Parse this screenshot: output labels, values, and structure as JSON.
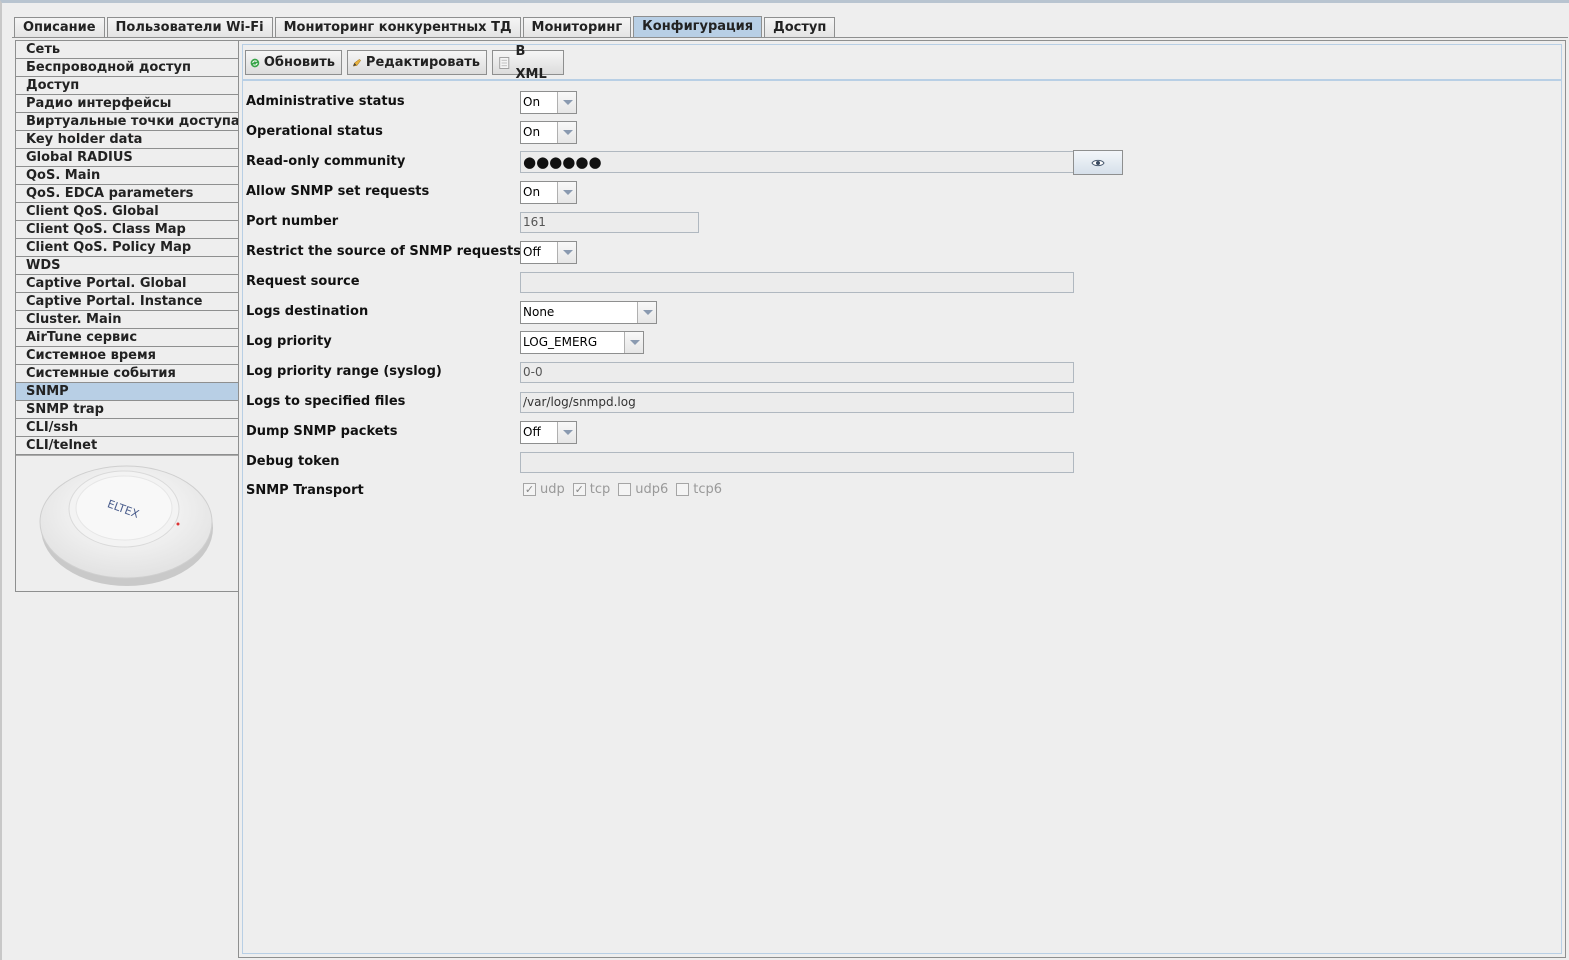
{
  "tabs": [
    {
      "label": "Описание",
      "active": false
    },
    {
      "label": "Пользователи Wi-Fi",
      "active": false
    },
    {
      "label": "Мониторинг конкурентных ТД",
      "active": false
    },
    {
      "label": "Мониторинг",
      "active": false
    },
    {
      "label": "Конфигурация",
      "active": true
    },
    {
      "label": "Доступ",
      "active": false
    }
  ],
  "sidebar": {
    "items": [
      {
        "label": "Сеть"
      },
      {
        "label": "Беспроводной доступ"
      },
      {
        "label": "Доступ"
      },
      {
        "label": "Радио интерфейсы"
      },
      {
        "label": "Виртуальные точки доступа"
      },
      {
        "label": "Key holder data"
      },
      {
        "label": "Global RADIUS"
      },
      {
        "label": "QoS. Main"
      },
      {
        "label": "QoS. EDCA parameters"
      },
      {
        "label": "Client QoS. Global"
      },
      {
        "label": "Client QoS. Class Map"
      },
      {
        "label": "Client QoS. Policy Map"
      },
      {
        "label": "WDS"
      },
      {
        "label": "Captive Portal. Global"
      },
      {
        "label": "Captive Portal. Instance"
      },
      {
        "label": "Cluster. Main"
      },
      {
        "label": "AirTune сервис"
      },
      {
        "label": "Системное время"
      },
      {
        "label": "Системные события"
      },
      {
        "label": "SNMP",
        "selected": true
      },
      {
        "label": "SNMP trap"
      },
      {
        "label": "CLI/ssh"
      },
      {
        "label": "CLI/telnet"
      }
    ],
    "device_logo_text": "ELTEX"
  },
  "toolbar": {
    "refresh_label": "Обновить",
    "edit_label": "Редактировать",
    "xml_label": "В XML"
  },
  "form": {
    "admin_status": {
      "label": "Administrative status",
      "value": "On"
    },
    "oper_status": {
      "label": "Operational status",
      "value": "On"
    },
    "ro_community": {
      "label": "Read-only community",
      "value": "●●●●●●"
    },
    "allow_set": {
      "label": "Allow SNMP set requests",
      "value": "On"
    },
    "port": {
      "label": "Port number",
      "value": "161"
    },
    "restrict_source": {
      "label": "Restrict the source of SNMP requests",
      "value": "Off"
    },
    "request_source": {
      "label": "Request source",
      "value": ""
    },
    "logs_destination": {
      "label": "Logs destination",
      "value": "None"
    },
    "log_priority": {
      "label": "Log priority",
      "value": "LOG_EMERG"
    },
    "log_priority_range": {
      "label": "Log priority range (syslog)",
      "value": "0-0"
    },
    "logs_files": {
      "label": "Logs to specified files",
      "value": "/var/log/snmpd.log"
    },
    "dump_packets": {
      "label": "Dump SNMP packets",
      "value": "Off"
    },
    "debug_token": {
      "label": "Debug token",
      "value": ""
    },
    "transport": {
      "label": "SNMP Transport",
      "options": [
        {
          "label": "udp",
          "checked": true
        },
        {
          "label": "tcp",
          "checked": true
        },
        {
          "label": "udp6",
          "checked": false
        },
        {
          "label": "tcp6",
          "checked": false
        }
      ]
    }
  }
}
